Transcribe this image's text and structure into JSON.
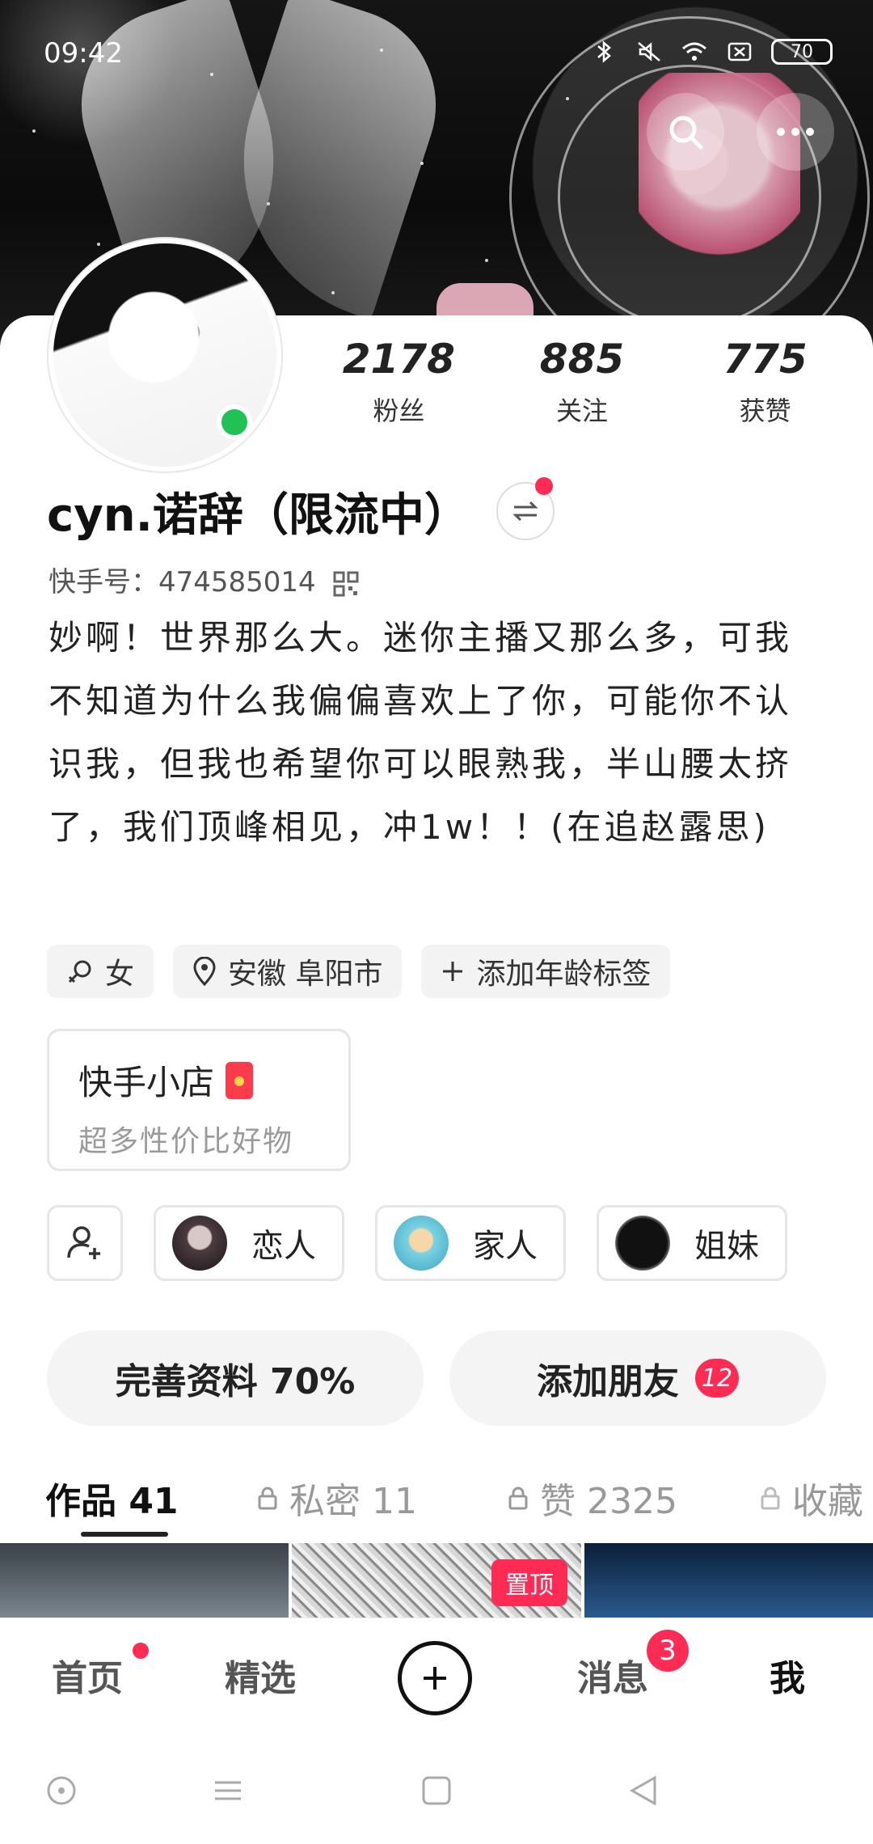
{
  "status_bar": {
    "time": "09:42",
    "battery": "70"
  },
  "profile": {
    "followers_count": "2178",
    "followers_label": "粉丝",
    "following_count": "885",
    "following_label": "关注",
    "likes_count": "775",
    "likes_label": "获赞",
    "username": "cyn.诺辞（限流中）",
    "kwai_id": "快手号：474585014",
    "bio": "妙啊！世界那么大。迷你主播又那么多，可我不知道为什么我偏偏喜欢上了你，可能你不认识我，但我也希望你可以眼熟我，半山腰太挤了，我们顶峰相见，冲1w！！(在追赵露思)"
  },
  "tags": [
    {
      "icon": "female-icon",
      "label": "女"
    },
    {
      "icon": "location-icon",
      "label": "安徽 阜阳市"
    },
    {
      "icon": "plus-icon",
      "label": "添加年龄标签"
    }
  ],
  "shop": {
    "title": "快手小店",
    "subtitle": "超多性价比好物"
  },
  "relations": [
    {
      "label": "恋人"
    },
    {
      "label": "家人"
    },
    {
      "label": "姐妹"
    }
  ],
  "actions": {
    "complete_profile": "完善资料 70%",
    "add_friends": "添加朋友",
    "add_friends_badge": "12"
  },
  "tabs": {
    "works": "作品 41",
    "private": "私密 11",
    "liked": "赞 2325",
    "collected": "收藏"
  },
  "pin_label": "置顶",
  "bottom_nav": {
    "home": "首页",
    "featured": "精选",
    "messages": "消息",
    "messages_badge": "3",
    "me": "我"
  },
  "colors": {
    "accent": "#fe2c55",
    "online": "#21c156"
  }
}
